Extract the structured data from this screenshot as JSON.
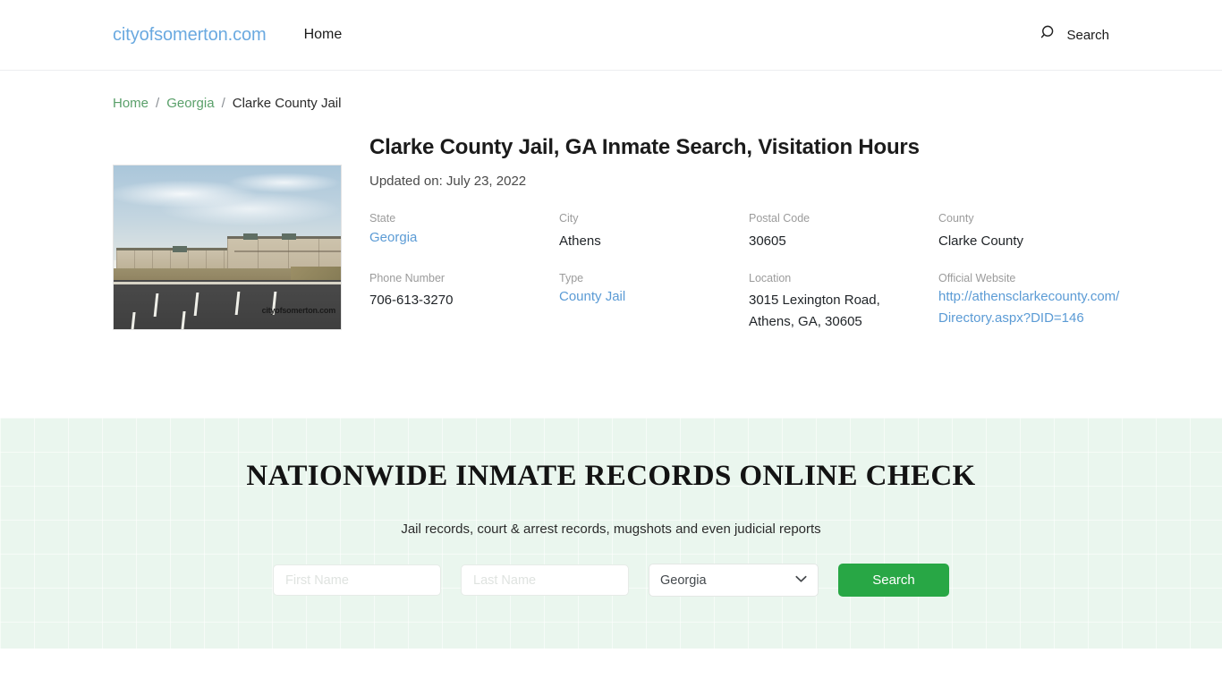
{
  "header": {
    "brand": "cityofsomerton.com",
    "nav": [
      {
        "label": "Home"
      }
    ],
    "search_label": "Search"
  },
  "breadcrumb": {
    "items": [
      {
        "label": "Home",
        "link": true
      },
      {
        "label": "Georgia",
        "link": true
      },
      {
        "label": "Clarke County Jail",
        "link": false
      }
    ],
    "separator": "/"
  },
  "article": {
    "title": "Clarke County Jail, GA Inmate Search, Visitation Hours",
    "updated": "Updated on: July 23, 2022",
    "image_watermark": "cityofsomerton.com",
    "info": [
      {
        "label": "State",
        "value": "Georgia",
        "link": true
      },
      {
        "label": "City",
        "value": "Athens",
        "link": false
      },
      {
        "label": "Postal Code",
        "value": "30605",
        "link": false
      },
      {
        "label": "County",
        "value": "Clarke County",
        "link": false
      },
      {
        "label": "Phone Number",
        "value": "706-613-3270",
        "link": false
      },
      {
        "label": "Type",
        "value": "County Jail",
        "link": true
      },
      {
        "label": "Location",
        "value": "3015 Lexington Road, Athens, GA, 30605",
        "link": false
      },
      {
        "label": "Official Website",
        "value": "http://athensclarkecounty.com/Directory.aspx?DID=146",
        "link": true
      }
    ]
  },
  "promo": {
    "title": "Nationwide Inmate Records Online Check",
    "subtitle": "Jail records, court & arrest records, mugshots and even judicial reports",
    "first_name_placeholder": "First Name",
    "first_name_value": "",
    "last_name_placeholder": "Last Name",
    "last_name_value": "",
    "state_selected": "Georgia",
    "state_options": [
      "Georgia"
    ],
    "search_button": "Search"
  },
  "colors": {
    "brand_blue": "#6aa9e0",
    "link_blue": "#5b9bd5",
    "crumb_green": "#5aa06a",
    "promo_bg": "#eaf6ee",
    "button_green": "#28a745"
  }
}
